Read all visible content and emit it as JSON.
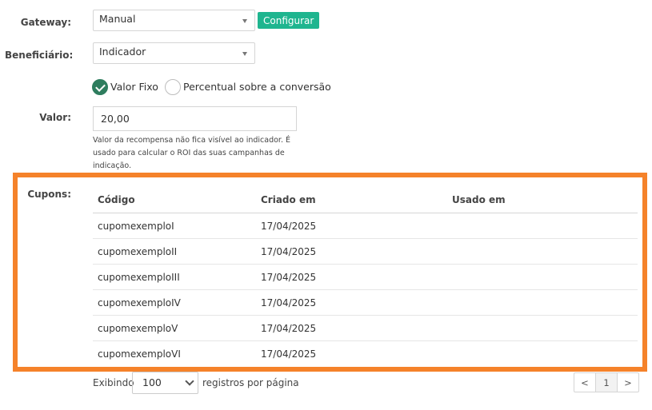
{
  "form": {
    "gateway_label": "Gateway:",
    "gateway_value": "Manual",
    "configurar_button": "Configurar",
    "beneficiario_label": "Beneficiário:",
    "beneficiario_value": "Indicador",
    "radio_fixo_label": "Valor Fixo",
    "radio_percentual_label": "Percentual sobre a conversão",
    "valor_label": "Valor:",
    "valor_value": "20,00",
    "valor_help": "Valor da recompensa não fica visível ao indicador. É usado para calcular o ROI das suas campanhas de indicação."
  },
  "cupons": {
    "label": "Cupons:",
    "columns": [
      "Código",
      "Criado em",
      "Usado em"
    ],
    "rows": [
      [
        "cupomexemploI",
        "17/04/2025",
        ""
      ],
      [
        "cupomexemploII",
        "17/04/2025",
        ""
      ],
      [
        "cupomexemploIII",
        "17/04/2025",
        ""
      ],
      [
        "cupomexemploIV",
        "17/04/2025",
        ""
      ],
      [
        "cupomexemploV",
        "17/04/2025",
        ""
      ],
      [
        "cupomexemploVI",
        "17/04/2025",
        ""
      ]
    ]
  },
  "footer": {
    "exibindo": "Exibindo",
    "per_page": "100",
    "registros": "registros por página",
    "prev": "<",
    "page": "1",
    "next": ">"
  },
  "colors": {
    "accent": "#1fb58f",
    "radio_checked": "#2e7d5e",
    "highlight": "#f5822a"
  }
}
